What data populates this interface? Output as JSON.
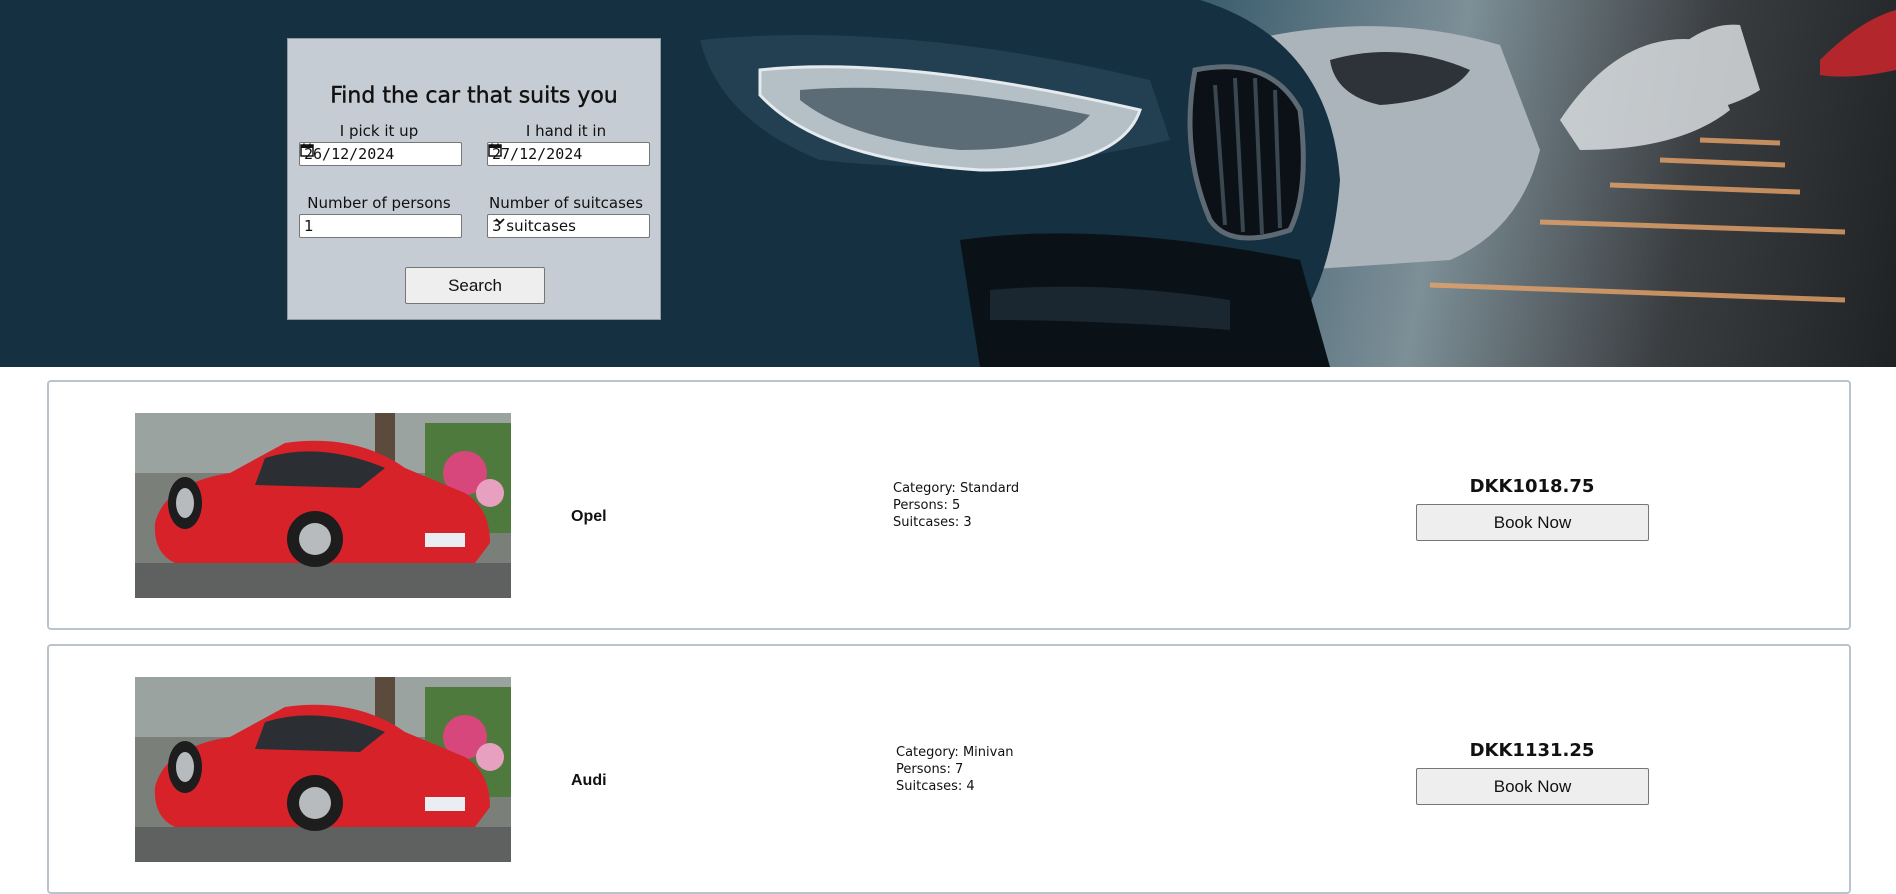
{
  "search_panel": {
    "title": "Find the car that suits you",
    "pickup_label": "I pick it up",
    "pickup_value": "26/12/2024",
    "return_label": "I hand it in",
    "return_value": "27/12/2024",
    "persons_label": "Number of persons",
    "persons_value": "1",
    "suitcases_label": "Number of suitcases",
    "suitcases_value": "3 suitcases",
    "search_label": "Search"
  },
  "cars": [
    {
      "name": "Opel",
      "category": "Category: Standard",
      "persons": "Persons: 5",
      "suitcases": "Suitcases: 3",
      "price": "DKK1018.75",
      "book_label": "Book Now"
    },
    {
      "name": "Audi",
      "category": "Category: Minivan",
      "persons": "Persons: 7",
      "suitcases": "Suitcases: 4",
      "price": "DKK1131.25",
      "book_label": "Book Now"
    }
  ],
  "icons": {
    "date": "calendar-icon",
    "select": "chevron-down-icon"
  },
  "colors": {
    "panel_bg": "#c5ccd3",
    "card_border": "#b9c4ce",
    "button_bg": "#eeeeee",
    "car_red": "#d8222a"
  }
}
